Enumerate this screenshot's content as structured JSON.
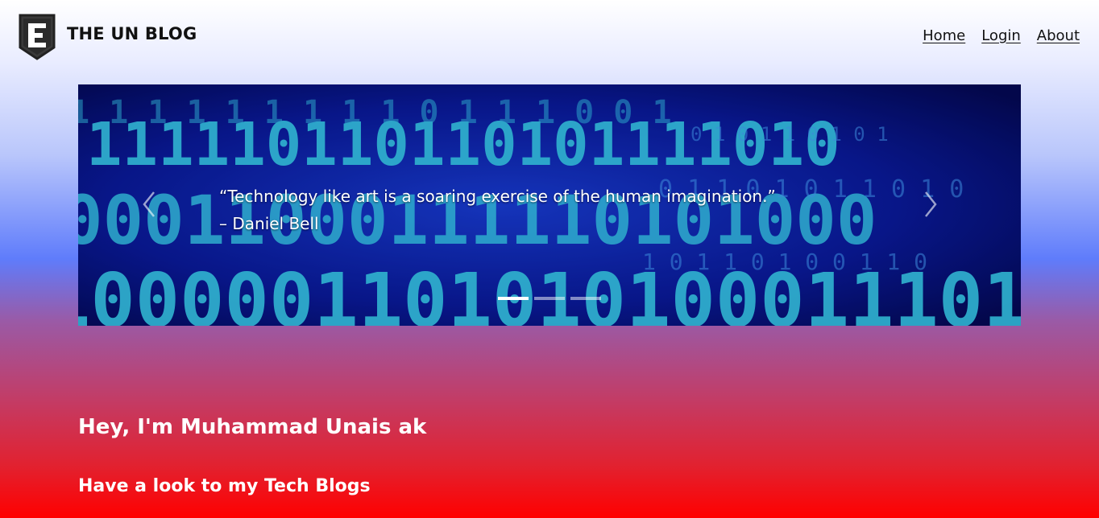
{
  "brand": {
    "title": "THE UN BLOG",
    "logo_icon": "shield-e-logo-icon"
  },
  "nav": {
    "items": [
      "Home",
      "Login",
      "About"
    ]
  },
  "carousel": {
    "quote": "“Technology like art is a soaring exercise of the human imagination.”",
    "author": "– Daniel Bell",
    "background": "binary-code-image",
    "prev_icon": "chevron-left-icon",
    "next_icon": "chevron-right-icon",
    "slide_count": 3,
    "active_slide": 1
  },
  "intro": {
    "heading": "Hey, I'm Muhammad Unais ak",
    "subheading": "Have a look to my Tech Blogs"
  },
  "colors": {
    "gradient_top": "#ffffff",
    "gradient_mid": "#5f7cfb",
    "gradient_bottom": "#ff0000",
    "carousel_bg": "#050a5a",
    "binary_digits": "#3ad6f0"
  }
}
